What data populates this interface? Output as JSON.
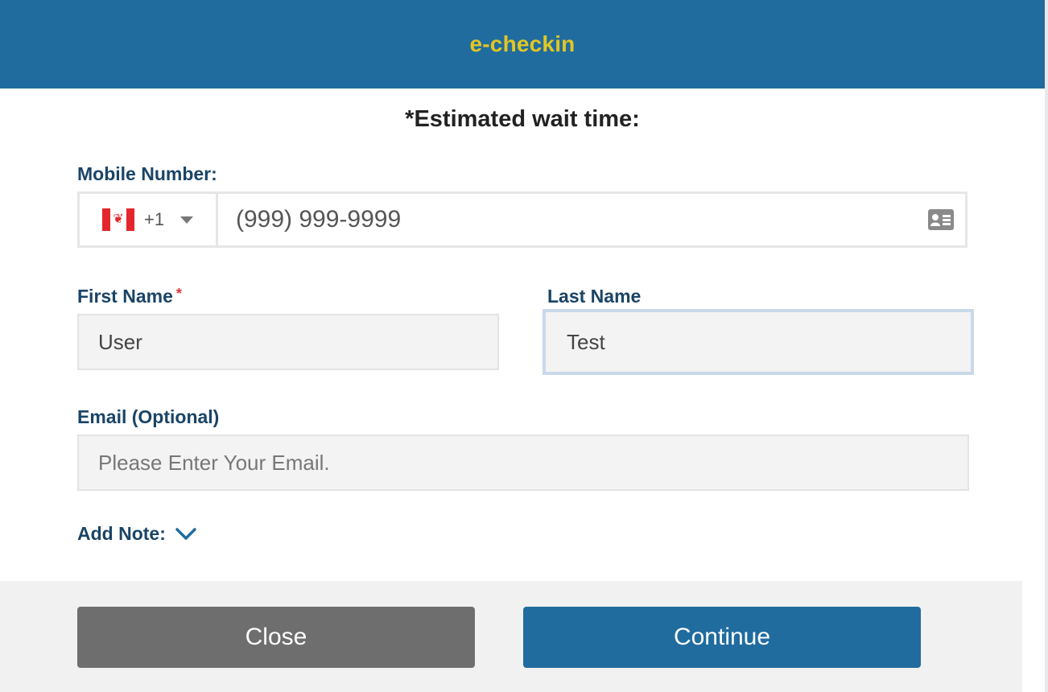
{
  "header": {
    "title": "e-checkin"
  },
  "wait_time": {
    "label": "*Estimated wait time:"
  },
  "mobile": {
    "label": "Mobile Number:",
    "country_flag_icon": "canada-flag-icon",
    "dial_code": "+1",
    "placeholder": "(999) 999-9999",
    "contact_icon": "contact-card-icon"
  },
  "first_name": {
    "label": "First Name",
    "required_mark": "*",
    "value": "User"
  },
  "last_name": {
    "label": "Last Name",
    "value": "Test"
  },
  "email": {
    "label": "Email (Optional)",
    "placeholder": "Please Enter Your Email.",
    "value": ""
  },
  "note": {
    "label": "Add Note:",
    "icon": "chevron-down-icon"
  },
  "buttons": {
    "close": "Close",
    "continue": "Continue"
  },
  "colors": {
    "header_bg": "#206c9f",
    "header_title": "#e2c623",
    "label": "#1a4466",
    "close_button": "#6e6e6e",
    "continue_button": "#206c9f",
    "required": "#d93535"
  }
}
